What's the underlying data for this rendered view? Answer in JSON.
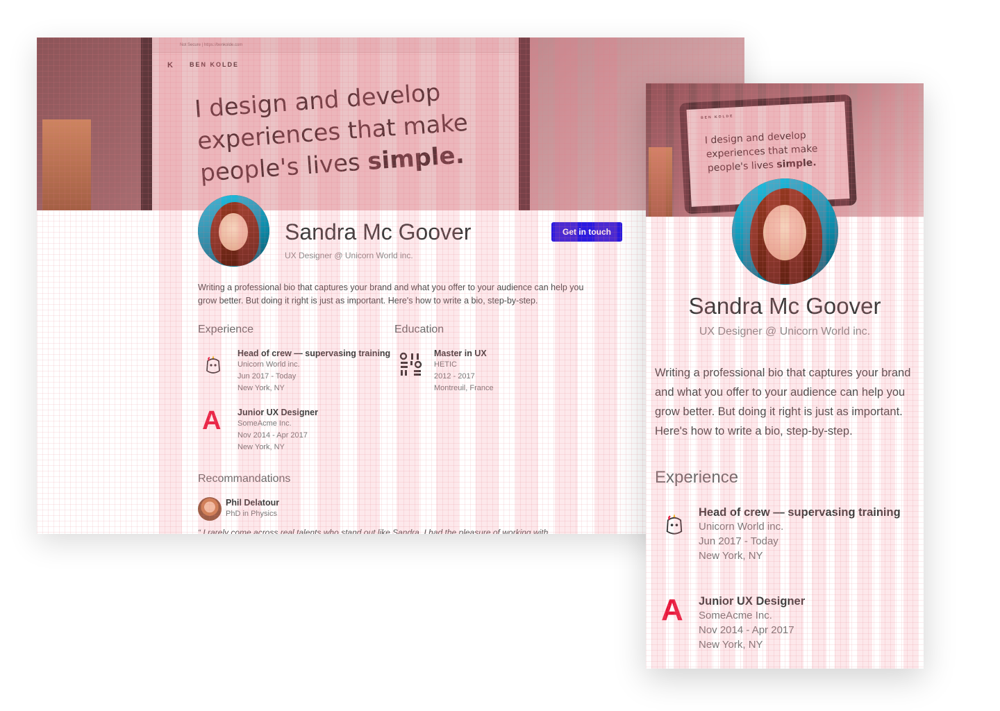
{
  "brand": {
    "name": "BEN KOLDE",
    "url": "Not Secure | https://benkolde.com"
  },
  "hero": {
    "line1": "I design and develop",
    "line2": "experiences that make",
    "line3_prefix": "people's lives ",
    "line3_strong": "simple."
  },
  "profile": {
    "name": "Sandra Mc Goover",
    "subtitle": "UX Designer @ Unicorn World inc.",
    "cta_label": "Get in touch",
    "bio": "Writing a professional bio that captures your brand and what you offer to your audience can help you grow better. But doing it right is just as important. Here's how to write a bio, step-by-step."
  },
  "experience": {
    "title": "Experience",
    "items": [
      {
        "role": "Head of crew — supervasing training",
        "company": "Unicorn World inc.",
        "dates": "Jun 2017 - Today",
        "location": "New York, NY",
        "logo": "unicorn-logo-icon"
      },
      {
        "role": "Junior UX Designer",
        "company": "SomeAcme Inc.",
        "dates": "Nov 2014 - Apr 2017",
        "location": "New York, NY",
        "logo": "acme-a-logo-icon"
      }
    ]
  },
  "education": {
    "title": "Education",
    "items": [
      {
        "degree": "Master in UX",
        "school": "HETIC",
        "dates": "2012 - 2017",
        "location": "Montreuil, France",
        "logo": "hetic-logo-icon"
      }
    ]
  },
  "recommendations": {
    "title": "Recommandations",
    "items": [
      {
        "name": "Phil Delatour",
        "title": "PhD in Physics",
        "quote": "“ I rarely come across real talents who stand out like Sandra. I had the pleasure of working with"
      }
    ]
  },
  "colors": {
    "accent": "#2a1ae0",
    "grid": "#f3a1ad",
    "logo_red": "#e8173b"
  }
}
